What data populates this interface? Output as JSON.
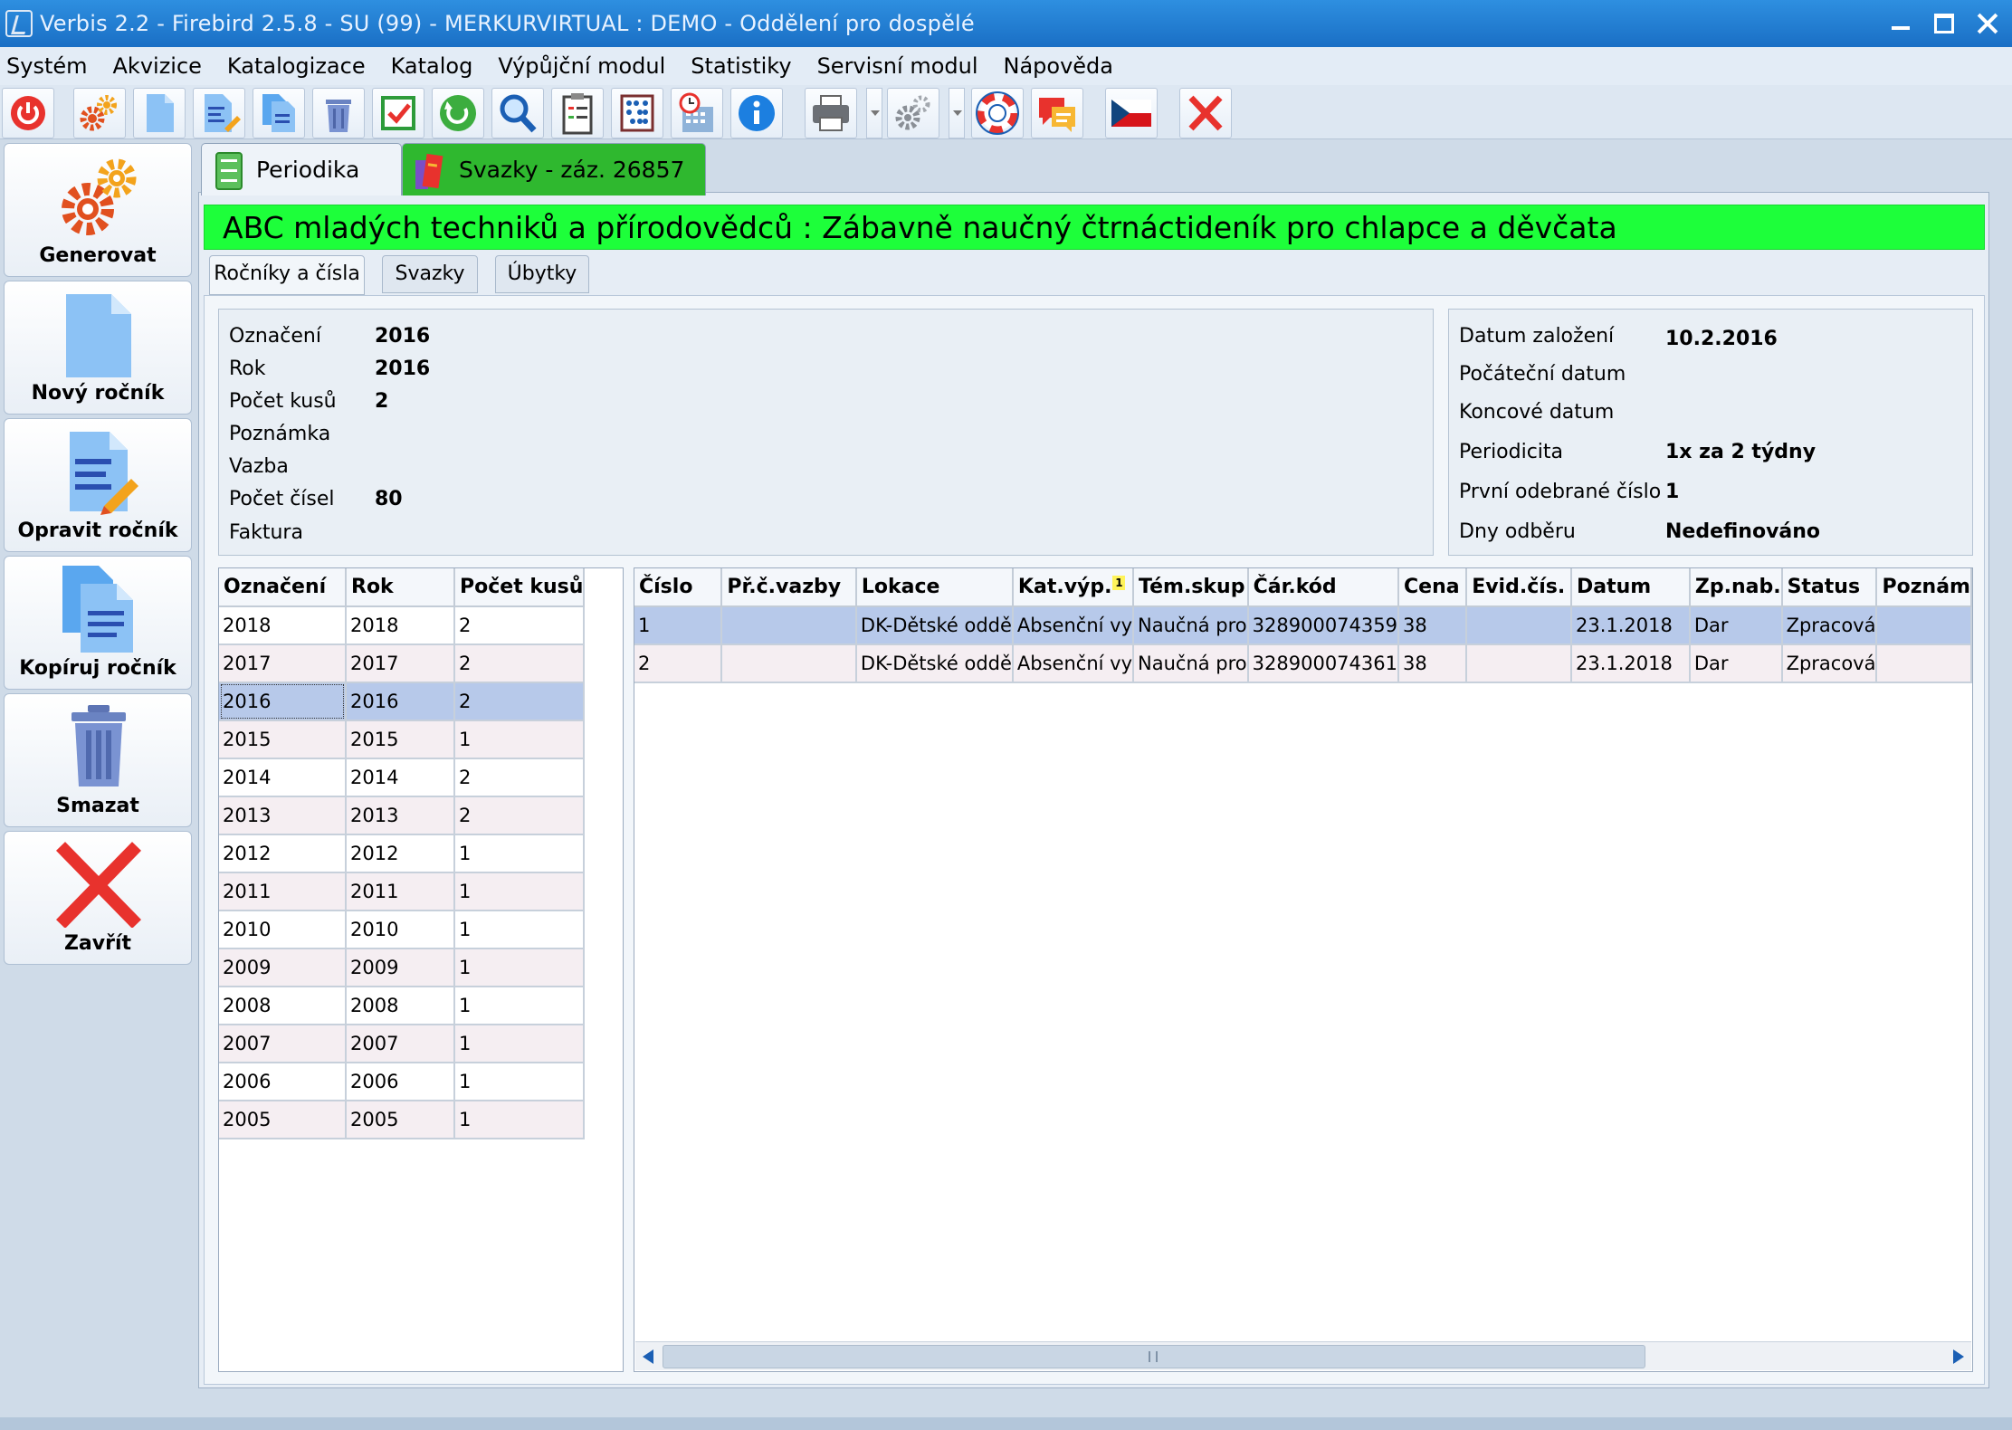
{
  "window": {
    "title": "Verbis 2.2 - Firebird 2.5.8 - SU (99) - MERKURVIRTUAL : DEMO - Oddělení pro dospělé"
  },
  "menu": [
    "Systém",
    "Akvizice",
    "Katalogizace",
    "Katalog",
    "Výpůjční modul",
    "Statistiky",
    "Servisní modul",
    "Nápověda"
  ],
  "toolbar": {
    "buttons": [
      {
        "name": "power-button",
        "icon": "power-icon"
      },
      {
        "name": "generate-button",
        "icon": "gears-icon"
      },
      {
        "name": "new-button",
        "icon": "new-document-icon"
      },
      {
        "name": "edit-button",
        "icon": "edit-document-icon"
      },
      {
        "name": "copy-button",
        "icon": "copy-documents-icon"
      },
      {
        "name": "delete-button",
        "icon": "trash-icon"
      },
      {
        "name": "confirm-button",
        "icon": "checkbox-icon"
      },
      {
        "name": "refresh-button",
        "icon": "refresh-icon"
      },
      {
        "name": "search-button",
        "icon": "magnifier-icon"
      },
      {
        "name": "clipboard-button",
        "icon": "clipboard-icon"
      },
      {
        "name": "abacus-button",
        "icon": "abacus-icon"
      },
      {
        "name": "schedule-button",
        "icon": "calendar-clock-icon"
      },
      {
        "name": "info-button",
        "icon": "info-icon"
      },
      {
        "name": "print-button",
        "icon": "printer-icon"
      },
      {
        "name": "settings-button",
        "icon": "gear-icon"
      },
      {
        "name": "help-button",
        "icon": "lifebuoy-icon"
      },
      {
        "name": "messages-button",
        "icon": "chat-icon"
      },
      {
        "name": "language-button",
        "icon": "czech-flag-icon"
      },
      {
        "name": "close-toolbar-button",
        "icon": "close-icon"
      }
    ]
  },
  "sidebar": {
    "buttons": [
      {
        "label": "Generovat",
        "icon": "gears-icon"
      },
      {
        "label": "Nový ročník",
        "icon": "new-document-icon"
      },
      {
        "label": "Opravit ročník",
        "icon": "edit-document-icon"
      },
      {
        "label": "Kopíruj ročník",
        "icon": "copy-documents-icon"
      },
      {
        "label": "Smazat",
        "icon": "trash-icon"
      },
      {
        "label": "Zavřít",
        "icon": "close-icon"
      }
    ]
  },
  "doc_tabs": {
    "periodika": "Periodika",
    "svazky": "Svazky - záz. 26857"
  },
  "record": {
    "title": "ABC mladých techniků a přírodovědců : Zábavně naučný čtrnáctideník pro chlapce a děvčata"
  },
  "sub_tabs": {
    "rocniky": "Ročníky a čísla",
    "svazky": "Svazky",
    "ubytky": "Úbytky"
  },
  "info_left": [
    {
      "label": "Označení",
      "value": "2016"
    },
    {
      "label": "Rok",
      "value": "2016"
    },
    {
      "label": "Počet kusů",
      "value": "2"
    },
    {
      "label": "Poznámka",
      "value": ""
    },
    {
      "label": "Vazba",
      "value": ""
    },
    {
      "label": "Počet čísel",
      "value": "80"
    },
    {
      "label": "Faktura",
      "value": ""
    }
  ],
  "info_right": [
    {
      "label": "Datum založení",
      "value": "10.2.2016"
    },
    {
      "label": "Počáteční datum",
      "value": ""
    },
    {
      "label": "Koncové datum",
      "value": ""
    },
    {
      "label": "Periodicita",
      "value": "1x za 2 týdny"
    },
    {
      "label": "První odebrané číslo",
      "value": "1"
    },
    {
      "label": "Dny odběru",
      "value": "Nedefinováno"
    }
  ],
  "years_grid": {
    "columns": [
      "Označení",
      "Rok",
      "Počet kusů"
    ],
    "selected_index": 2,
    "rows": [
      [
        "2018",
        "2018",
        "2"
      ],
      [
        "2017",
        "2017",
        "2"
      ],
      [
        "2016",
        "2016",
        "2"
      ],
      [
        "2015",
        "2015",
        "1"
      ],
      [
        "2014",
        "2014",
        "2"
      ],
      [
        "2013",
        "2013",
        "2"
      ],
      [
        "2012",
        "2012",
        "1"
      ],
      [
        "2011",
        "2011",
        "1"
      ],
      [
        "2010",
        "2010",
        "1"
      ],
      [
        "2009",
        "2009",
        "1"
      ],
      [
        "2008",
        "2008",
        "1"
      ],
      [
        "2007",
        "2007",
        "1"
      ],
      [
        "2006",
        "2006",
        "1"
      ],
      [
        "2005",
        "2005",
        "1"
      ]
    ]
  },
  "issues_grid": {
    "columns": [
      "Číslo",
      "Př.č.vazby",
      "Lokace",
      "Kat.výp.",
      "Tém.skup",
      "Čár.kód",
      "Cena",
      "Evid.čís.",
      "Datum",
      "Zp.nab.",
      "Status",
      "Poznám"
    ],
    "sort_badge": "1",
    "selected_index": 0,
    "rows": [
      [
        "1",
        "",
        "DK-Dětské oddě",
        "Absenční vy",
        "Naučná pro",
        "328900074359",
        "38",
        "",
        "23.1.2018",
        "Dar",
        "Zpracová",
        ""
      ],
      [
        "2",
        "",
        "DK-Dětské oddě",
        "Absenční vy",
        "Naučná pro",
        "328900074361",
        "38",
        "",
        "23.1.2018",
        "Dar",
        "Zpracová",
        ""
      ]
    ]
  },
  "colors": {
    "title_bar": "#1a6fc5",
    "record_title_bg": "#1dff3a",
    "active_tab": "#2fb82f",
    "selected_row": "#b7c9ea"
  }
}
